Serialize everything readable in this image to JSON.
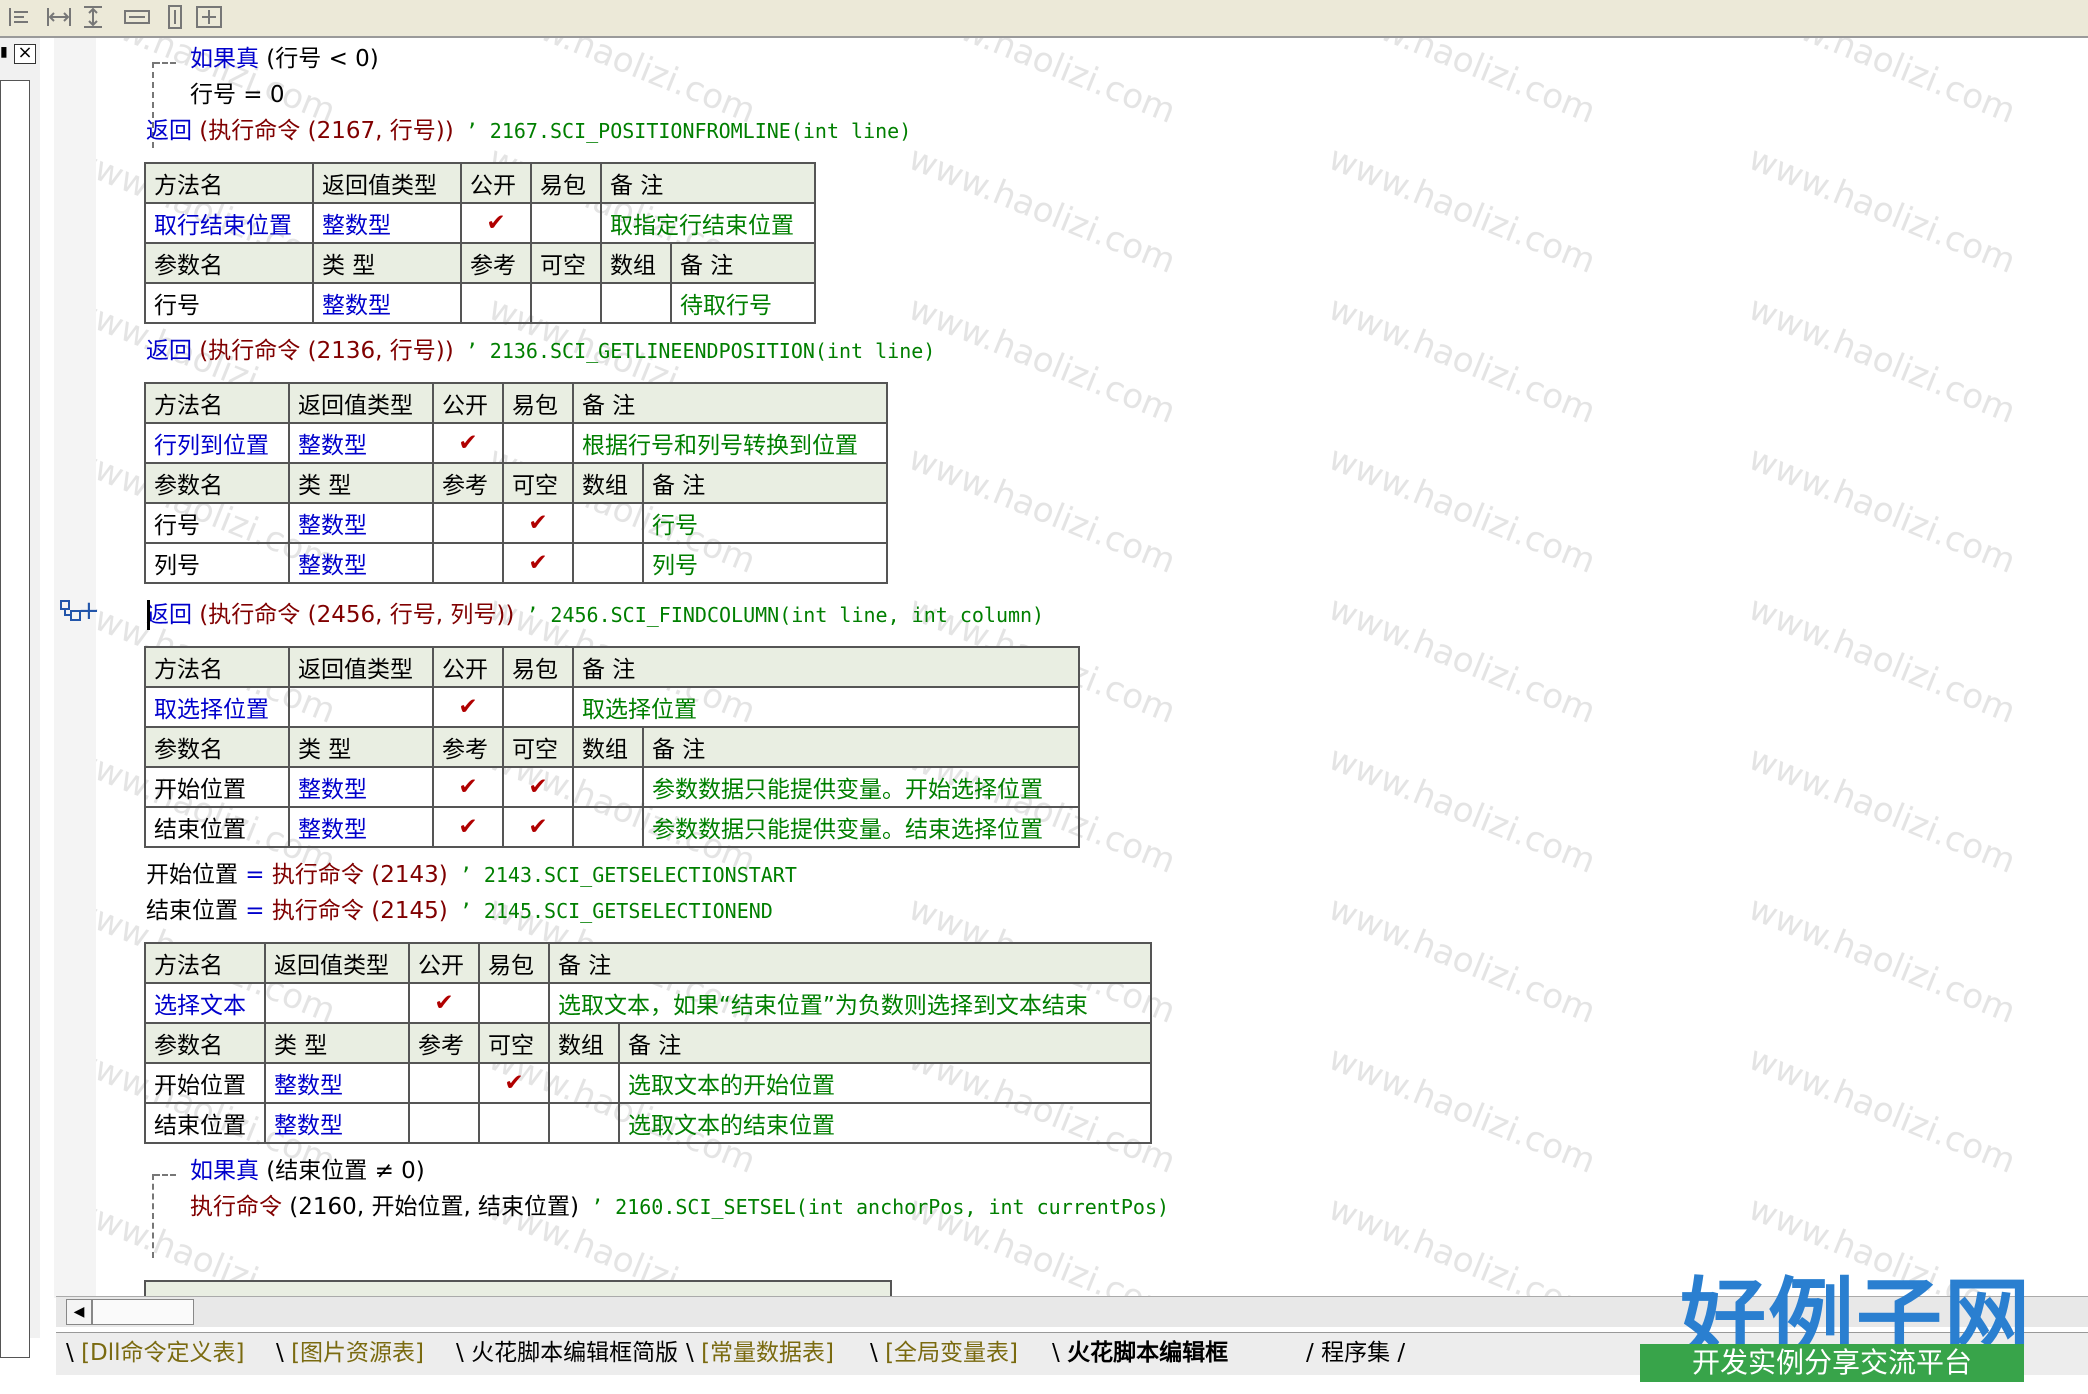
{
  "tabs": [
    {
      "label": "[Dll命令定义表]",
      "active": false
    },
    {
      "label": "[图片资源表]",
      "active": false
    },
    {
      "label": "火花脚本编辑框简版",
      "active": false
    },
    {
      "label": "[常量数据表]",
      "active": false
    },
    {
      "label": "[全局变量表]",
      "active": false
    },
    {
      "label": "火花脚本编辑框",
      "active": true
    },
    {
      "label": "程序集",
      "active": false
    }
  ],
  "panel": {
    "close_label": "×"
  },
  "gutter": {
    "expand_symbol": "+"
  },
  "code1": {
    "kw": "如果真",
    "cond": " (行号 < 0)",
    "assign": "行号 = 0",
    "ret_kw": "返回",
    "ret_call": " (执行命令 (2167, 行号))",
    "ret_comment": " ’ 2167.SCI_POSITIONFROMLINE(int line)"
  },
  "header_labels": {
    "method": "方法名",
    "ret_type": "返回值类型",
    "public": "公开",
    "easy": "易包",
    "note": "备 注",
    "param": "参数名",
    "type": "类 型",
    "ref": "参考",
    "nullable": "可空",
    "array": "数组"
  },
  "check": "✔",
  "table1": {
    "name": "取行结束位置",
    "ret": "整数型",
    "note": "取指定行结束位置",
    "params": [
      {
        "name": "行号",
        "type": "整数型",
        "note": "待取行号"
      }
    ]
  },
  "code2": {
    "ret_kw": "返回",
    "ret_call": " (执行命令 (2136, 行号))",
    "ret_comment": " ’ 2136.SCI_GETLINEENDPOSITION(int line)"
  },
  "table2": {
    "name": "行列到位置",
    "ret": "整数型",
    "note": "根据行号和列号转换到位置",
    "params": [
      {
        "name": "行号",
        "type": "整数型",
        "note": "行号"
      },
      {
        "name": "列号",
        "type": "整数型",
        "note": "列号"
      }
    ]
  },
  "code3": {
    "ret_kw": "返回",
    "ret_call": " (执行命令 (2456, 行号, 列号))",
    "ret_comment": " ’ 2456.SCI_FINDCOLUMN(int line, int column)"
  },
  "table3": {
    "name": "取选择位置",
    "ret": "",
    "note": "取选择位置",
    "params": [
      {
        "name": "开始位置",
        "type": "整数型",
        "note": "参数数据只能提供变量。开始选择位置"
      },
      {
        "name": "结束位置",
        "type": "整数型",
        "note": "参数数据只能提供变量。结束选择位置"
      }
    ]
  },
  "code4": {
    "l1_var": "开始位置",
    "l1_eq": " = ",
    "l1_fn": "执行命令",
    "l1_arg": " (2143)",
    "l1_comment": " ’ 2143.SCI_GETSELECTIONSTART",
    "l2_var": "结束位置",
    "l2_eq": " = ",
    "l2_fn": "执行命令",
    "l2_arg": " (2145)",
    "l2_comment": " ’ 2145.SCI_GETSELECTIONEND"
  },
  "table4": {
    "name": "选择文本",
    "ret": "",
    "note": "选取文本，如果“结束位置”为负数则选择到文本结束",
    "params": [
      {
        "name": "开始位置",
        "type": "整数型",
        "note": "选取文本的开始位置"
      },
      {
        "name": "结束位置",
        "type": "整数型",
        "note": "选取文本的结束位置"
      }
    ]
  },
  "code5": {
    "kw": "如果真",
    "cond": " (结束位置 ≠ 0)",
    "call_fn": "执行命令",
    "call_args": " (2160, 开始位置, 结束位置)",
    "call_comment": " ’ 2160.SCI_SETSEL(int anchorPos, int currentPos)"
  },
  "watermark": "www.haolizi.com",
  "logo": {
    "big": "好例子网",
    "small": "开发实例分享交流平台"
  }
}
